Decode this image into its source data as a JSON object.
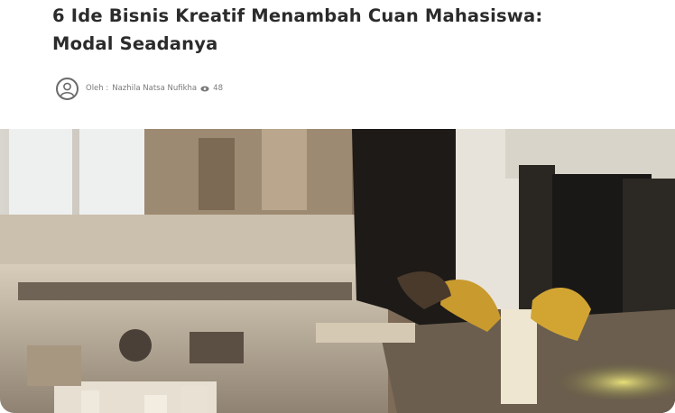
{
  "article": {
    "title_line1": "6 Ide Bisnis Kreatif Menambah Cuan Mahasiswa:",
    "title_line2": "Modal Seadanya",
    "author_prefix": "Oleh :",
    "author_name": "Nazhila Natsa Nufikha",
    "views": "48",
    "icons": {
      "avatar": "user-circle-icon",
      "views": "eye-icon"
    }
  },
  "hero_image": {
    "description_alt": "Woodworking workshop with bandsaw"
  },
  "colors": {
    "text": "#2b2b2b",
    "meta": "#7a7a7a",
    "background": "#ffffff"
  }
}
